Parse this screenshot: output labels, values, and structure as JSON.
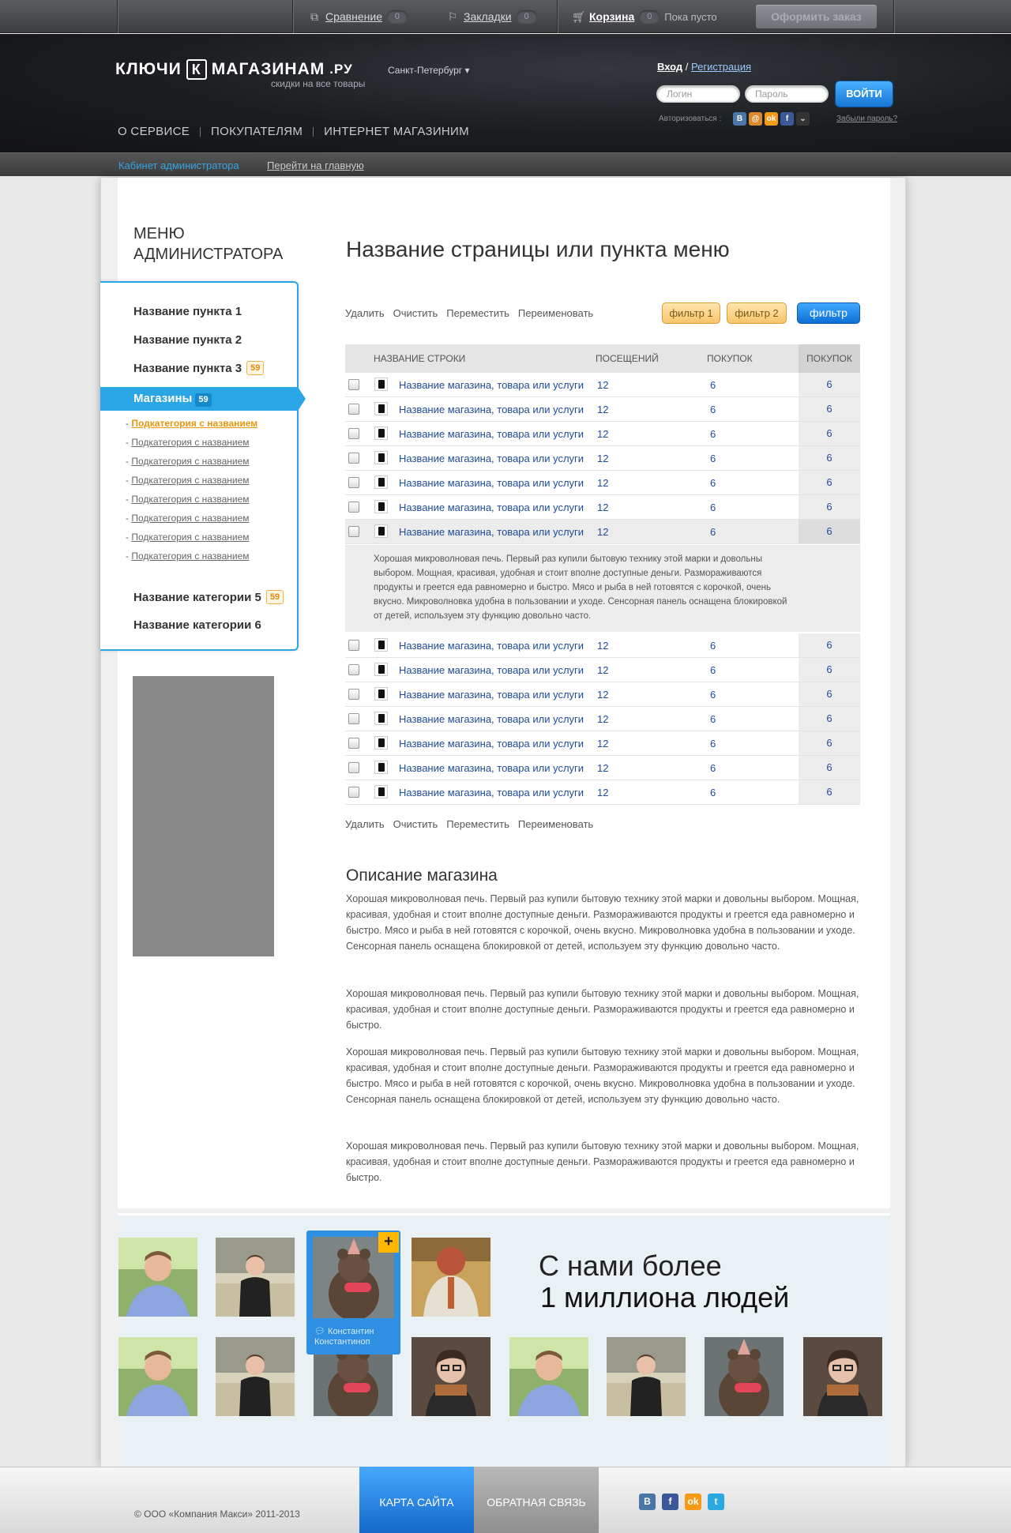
{
  "topbar": {
    "compare_label": "Сравнение",
    "compare_count": "0",
    "bookmarks_label": "Закладки",
    "bookmarks_count": "0",
    "cart_label": "Корзина",
    "cart_count": "0",
    "cart_status": "Пока пусто",
    "order_button": "Оформить заказ"
  },
  "header": {
    "logo_left": "КЛЮЧИ",
    "logo_k": "К",
    "logo_right": "МАГАЗИНАМ",
    "logo_ru": ".РУ",
    "city": "Санкт-Петербург ▾",
    "slogan": "скидки на все товары",
    "nav": [
      "О СЕРВИСЕ",
      "ПОКУПАТЕЛЯМ",
      "ИНТЕРНЕТ МАГАЗИНИМ"
    ],
    "login_link": "Вход",
    "login_sep": " / ",
    "register_link": "Регистрация",
    "login_placeholder": "Логин",
    "password_placeholder": "Пароль",
    "login_button": "ВОЙТИ",
    "social_label": "Авторизоваться :",
    "forgot": "Забыли пароль?"
  },
  "adminbar": {
    "cabinet": "Кабинет администратора",
    "go_home": "Перейти на главную"
  },
  "sidebar": {
    "title_line1": "МЕНЮ",
    "title_line2": "АДМИНИСТРАТОРА",
    "items": [
      {
        "label": "Название пункта 1"
      },
      {
        "label": "Название пункта 2"
      },
      {
        "label": "Название пункта 3",
        "badge": "59"
      }
    ],
    "active": {
      "label": "Магазины",
      "badge": "59"
    },
    "subitems": [
      "Подкатегория с названием",
      "Подкатегория с названием",
      "Подкатегория с названием",
      "Подкатегория с названием",
      "Подкатегория с названием",
      "Подкатегория с названием",
      "Подкатегория с названием",
      "Подкатегория с названием"
    ],
    "categories": [
      {
        "label": "Название категории 5",
        "badge": "59"
      },
      {
        "label": "Название категории 6"
      }
    ]
  },
  "main": {
    "title": "Название страницы или пункта меню",
    "actions": [
      "Удалить",
      "Очистить",
      "Переместить",
      "Переименовать"
    ],
    "filter1": "фильтр 1",
    "filter2": "фильтр 2",
    "filter_button": "фильтр",
    "table": {
      "headers": [
        "НАЗВАНИЕ СТРОКИ",
        "ПОСЕЩЕНИЙ",
        "ПОКУПОК",
        "ПОКУПОК"
      ],
      "rows": [
        [
          "Название магазина, товара или услуги",
          "12",
          "6",
          "6"
        ],
        [
          "Название магазина, товара или услуги",
          "12",
          "6",
          "6"
        ],
        [
          "Название магазина, товара или услуги",
          "12",
          "6",
          "6"
        ],
        [
          "Название магазина, товара или услуги",
          "12",
          "6",
          "6"
        ],
        [
          "Название магазина, товара или услуги",
          "12",
          "6",
          "6"
        ],
        [
          "Название магазина, товара или услуги",
          "12",
          "6",
          "6"
        ],
        [
          "Название магазина, товара или услуги",
          "12",
          "6",
          "6"
        ],
        [
          "Название магазина, товара или услуги",
          "12",
          "6",
          "6"
        ],
        [
          "Название магазина, товара или услуги",
          "12",
          "6",
          "6"
        ],
        [
          "Название магазина, товара или услуги",
          "12",
          "6",
          "6"
        ],
        [
          "Название магазина, товара или услуги",
          "12",
          "6",
          "6"
        ],
        [
          "Название магазина, товара или услуги",
          "12",
          "6",
          "6"
        ],
        [
          "Название магазина, товара или услуги",
          "12",
          "6",
          "6"
        ],
        [
          "Название магазина, товара или услуги",
          "12",
          "6",
          "6"
        ]
      ],
      "expanded_text": "Хорошая микроволновая печь. Первый раз купили бытовую технику этой марки и довольны выбором. Мощная, красивая, удобная и стоит вполне доступные деньги. Размораживаются продукты и греется еда равномерно и быстро. Мясо и рыба в ней готовятся с корочкой, очень вкусно. Микроволновка удобна в пользовании и уходе. Сенсорная панель оснащена блокировкой от детей, используем эту функцию довольно часто."
    },
    "desc_title": "Описание магазина",
    "paragraphs": [
      "Хорошая микроволновая печь. Первый раз купили бытовую технику этой марки и довольны выбором. Мощная, красивая, удобная и стоит вполне доступные деньги. Размораживаются продукты и греется еда равномерно и быстро. Мясо и рыба в ней готовятся с корочкой, очень вкусно. Микроволновка удобна в пользовании и уходе. Сенсорная панель оснащена блокировкой от детей, используем эту функцию довольно часто.",
      "Хорошая микроволновая печь. Первый раз купили бытовую технику этой марки и довольны выбором. Мощная, красивая, удобная и стоит вполне доступные деньги. Размораживаются продукты и греется еда равномерно и быстро.",
      "Хорошая микроволновая печь. Первый раз купили бытовую технику этой марки и довольны выбором. Мощная, красивая, удобная и стоит вполне доступные деньги. Размораживаются продукты и греется еда равномерно и быстро. Мясо и рыба в ней готовятся с корочкой, очень вкусно. Микроволновка удобна в пользовании и уходе. Сенсорная панель оснащена блокировкой от детей, используем эту функцию довольно часто.",
      "Хорошая микроволновая печь. Первый раз купили бытовую технику этой марки и довольны выбором. Мощная, красивая, удобная и стоит вполне доступные деньги. Размораживаются продукты и греется еда равномерно и быстро."
    ]
  },
  "people": {
    "featured_name": "Константин Константиноп",
    "featured_plus": "+",
    "headline1": "С нами более",
    "headline2": "1 миллиона людей"
  },
  "footer": {
    "copyright": "© ООО «Компания Макси» 2011-2013",
    "sitemap": "КАРТА САЙТА",
    "feedback": "ОБРАТНАЯ СВЯЗЬ"
  },
  "colors": {
    "accent": "#2aa6e6",
    "badge": "#e8870e",
    "link": "#1f4b99"
  },
  "icons": [
    "compare-icon",
    "bookmark-icon",
    "cart-icon",
    "vk-icon",
    "mailru-icon",
    "odnoklassniki-icon",
    "facebook-icon",
    "twitter-icon"
  ]
}
